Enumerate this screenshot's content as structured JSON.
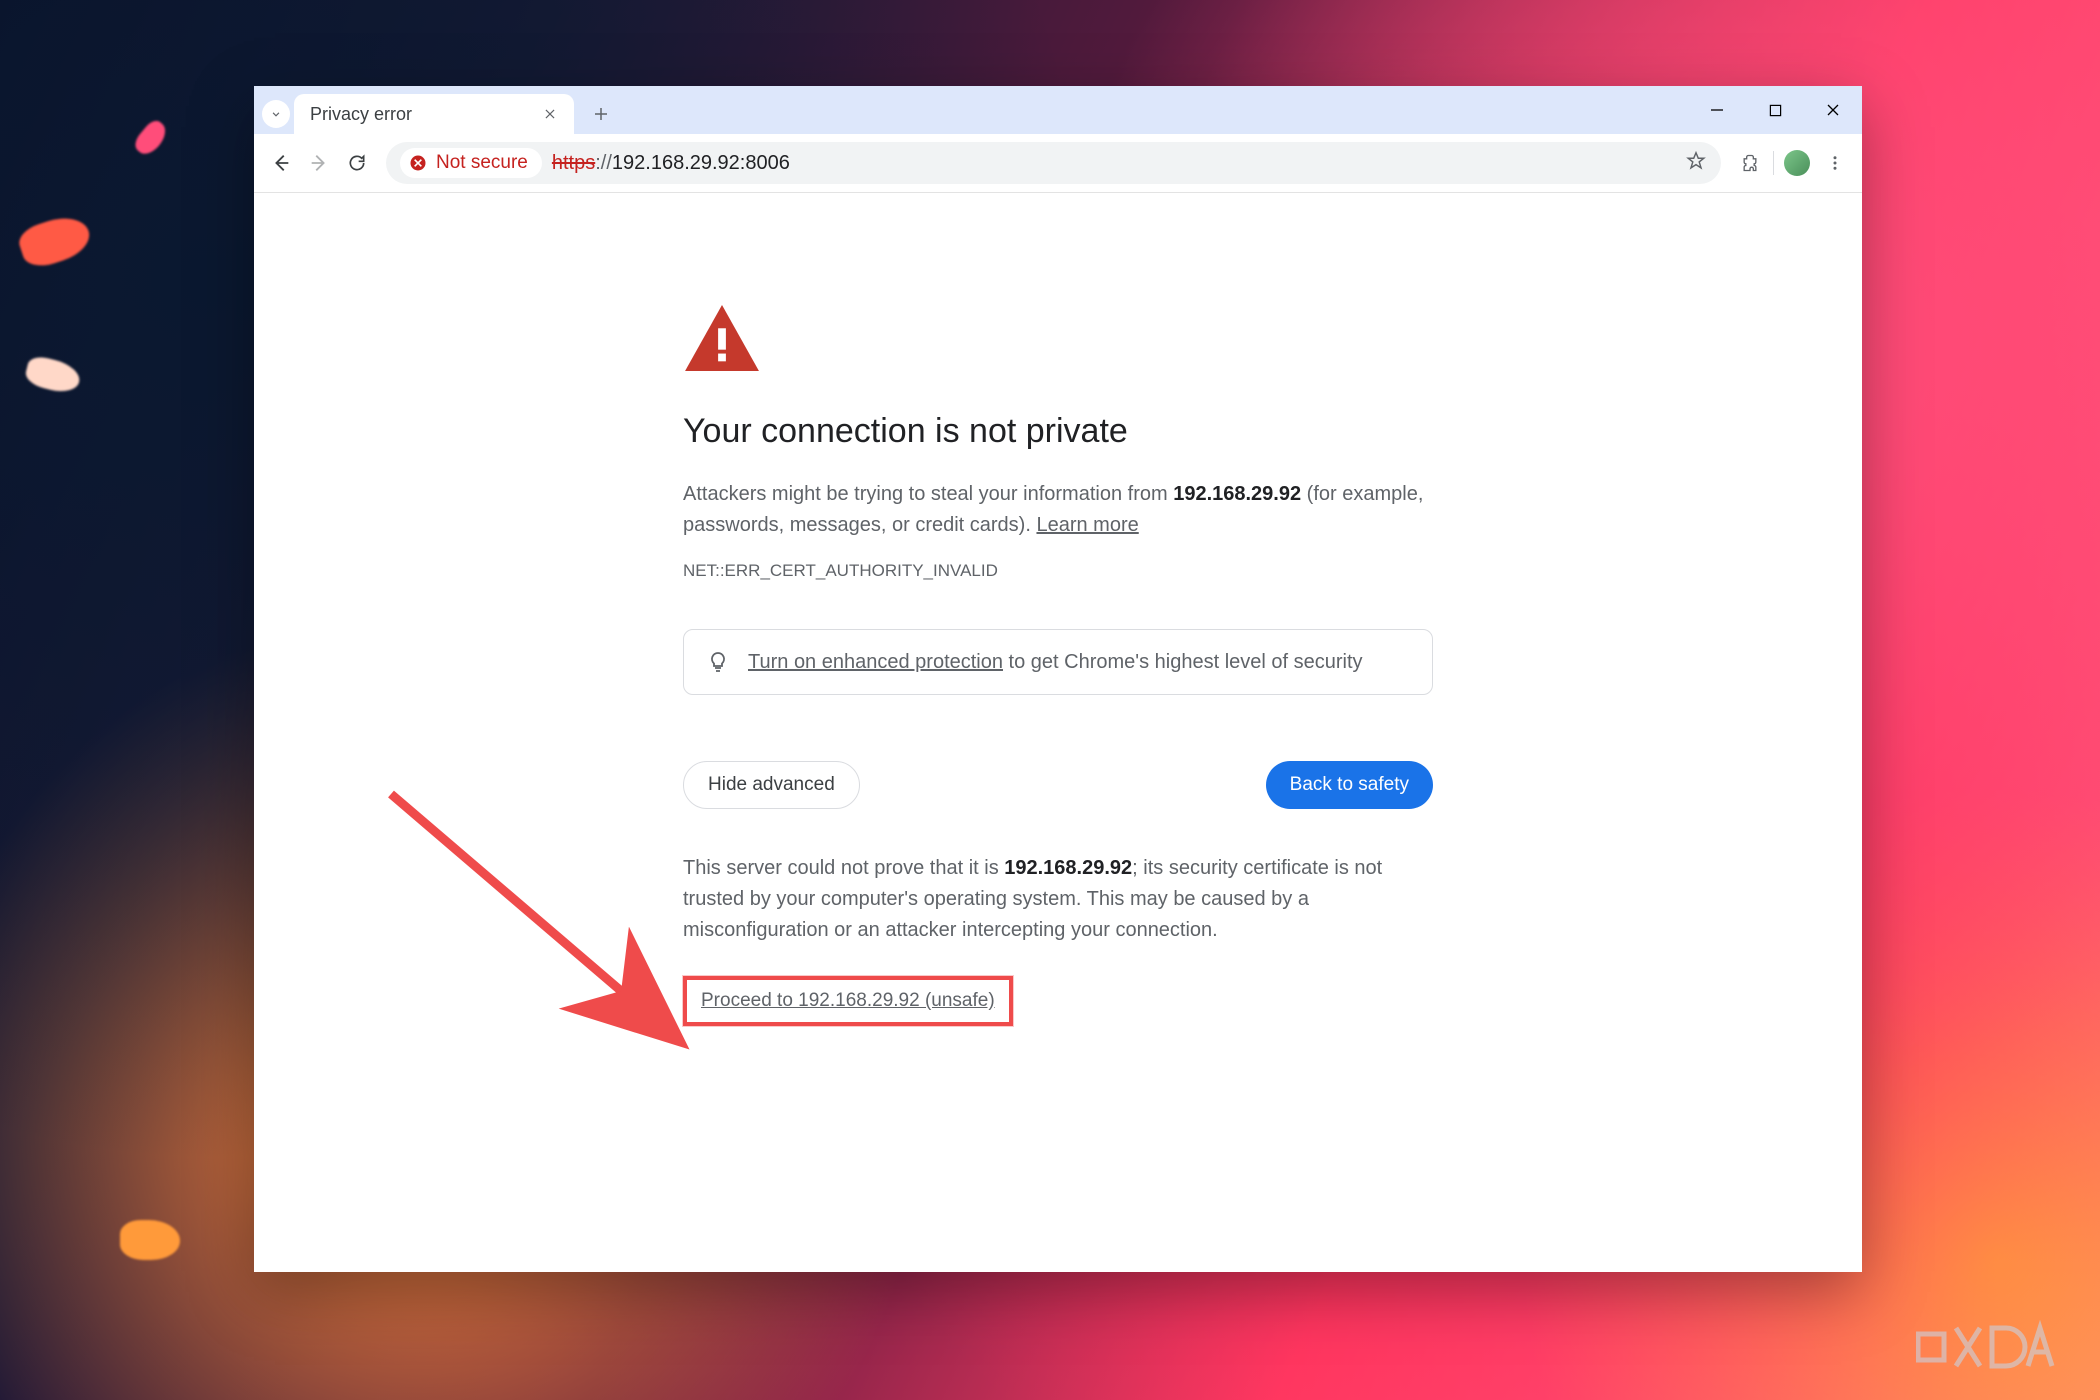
{
  "browser": {
    "tab_title": "Privacy error",
    "not_secure_label": "Not secure",
    "url_protocol": "https",
    "url_sep": "://",
    "url_host": "192.168.29.92:8006",
    "colors": {
      "danger": "#c5221f",
      "primary": "#1a73e8"
    }
  },
  "page": {
    "heading": "Your connection is not private",
    "warn_prefix": "Attackers might be trying to steal your information from ",
    "warn_host": "192.168.29.92",
    "warn_suffix": " (for example, passwords, messages, or credit cards). ",
    "learn_more": "Learn more",
    "error_code": "NET::ERR_CERT_AUTHORITY_INVALID",
    "tip_link": "Turn on enhanced protection",
    "tip_rest": " to get Chrome's highest level of security",
    "btn_hide": "Hide advanced",
    "btn_safety": "Back to safety",
    "adv_prefix": "This server could not prove that it is ",
    "adv_host": "192.168.29.92",
    "adv_suffix": "; its security certificate is not trusted by your computer's operating system. This may be caused by a misconfiguration or an attacker intercepting your connection.",
    "proceed": "Proceed to 192.168.29.92 (unsafe)"
  },
  "annotation": {
    "watermark": "XDA",
    "highlight_color": "#ef4b4b"
  }
}
